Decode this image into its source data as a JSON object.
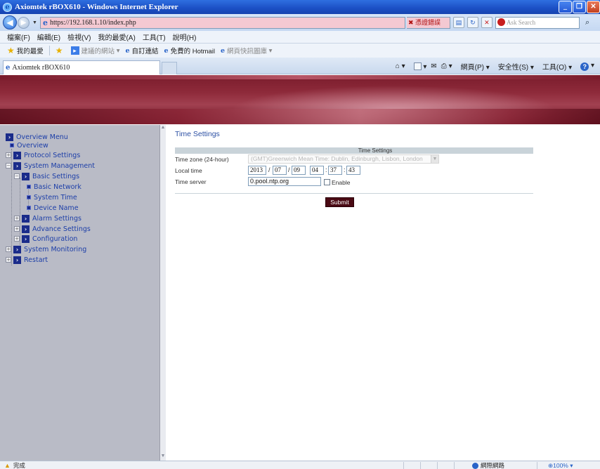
{
  "window": {
    "title": "Axiomtek rBOX610 - Windows Internet Explorer"
  },
  "address": {
    "url": "https://192.168.1.10/index.php",
    "cert_error": "憑證錯誤",
    "search_placeholder": "Ask Search"
  },
  "menubar": {
    "items": [
      "檔案(F)",
      "編輯(E)",
      "檢視(V)",
      "我的最愛(A)",
      "工具(T)",
      "說明(H)"
    ]
  },
  "favorites": {
    "label": "我的最愛",
    "suggested": "建議的網站",
    "links": [
      "自訂連結",
      "免費的 Hotmail",
      "網頁快訊圖庫"
    ]
  },
  "tab": {
    "title": "Axiomtek rBOX610"
  },
  "commandbar": {
    "page": "網頁(P)",
    "safety": "安全性(S)",
    "tools": "工具(O)"
  },
  "sidebar": {
    "items": [
      {
        "label": "Overview Menu"
      },
      {
        "label": "Overview"
      },
      {
        "label": "Protocol Settings"
      },
      {
        "label": "System Management"
      },
      {
        "label": "Basic Settings"
      },
      {
        "label": "Basic Network"
      },
      {
        "label": "System Time"
      },
      {
        "label": "Device Name"
      },
      {
        "label": "Alarm Settings"
      },
      {
        "label": "Advance Settings"
      },
      {
        "label": "Configuration"
      },
      {
        "label": "System Monitoring"
      },
      {
        "label": "Restart"
      }
    ]
  },
  "main": {
    "title": "Time Settings",
    "table_header": "Time Settings",
    "rows": {
      "timezone": {
        "label": "Time zone (24-hour)",
        "value": "(GMT)Greenwich Mean Time: Dublin, Edinburgh, Lisbon, London"
      },
      "localtime": {
        "label": "Local time",
        "year": "2013",
        "month": "07",
        "day": "09",
        "hour": "04",
        "minute": "37",
        "second": "43"
      },
      "timeserver": {
        "label": "Time server",
        "value": "0.pool.ntp.org",
        "enable_label": "Enable",
        "enabled": false
      }
    },
    "submit_label": "Submit"
  },
  "status": {
    "text": "完成",
    "zone": "網際網路",
    "zoom": "100%"
  },
  "colors": {
    "banner": "#7a1c2c",
    "sidebar": "#b9bbc6",
    "submit": "#4a0a14",
    "link": "#1c3ea8"
  }
}
